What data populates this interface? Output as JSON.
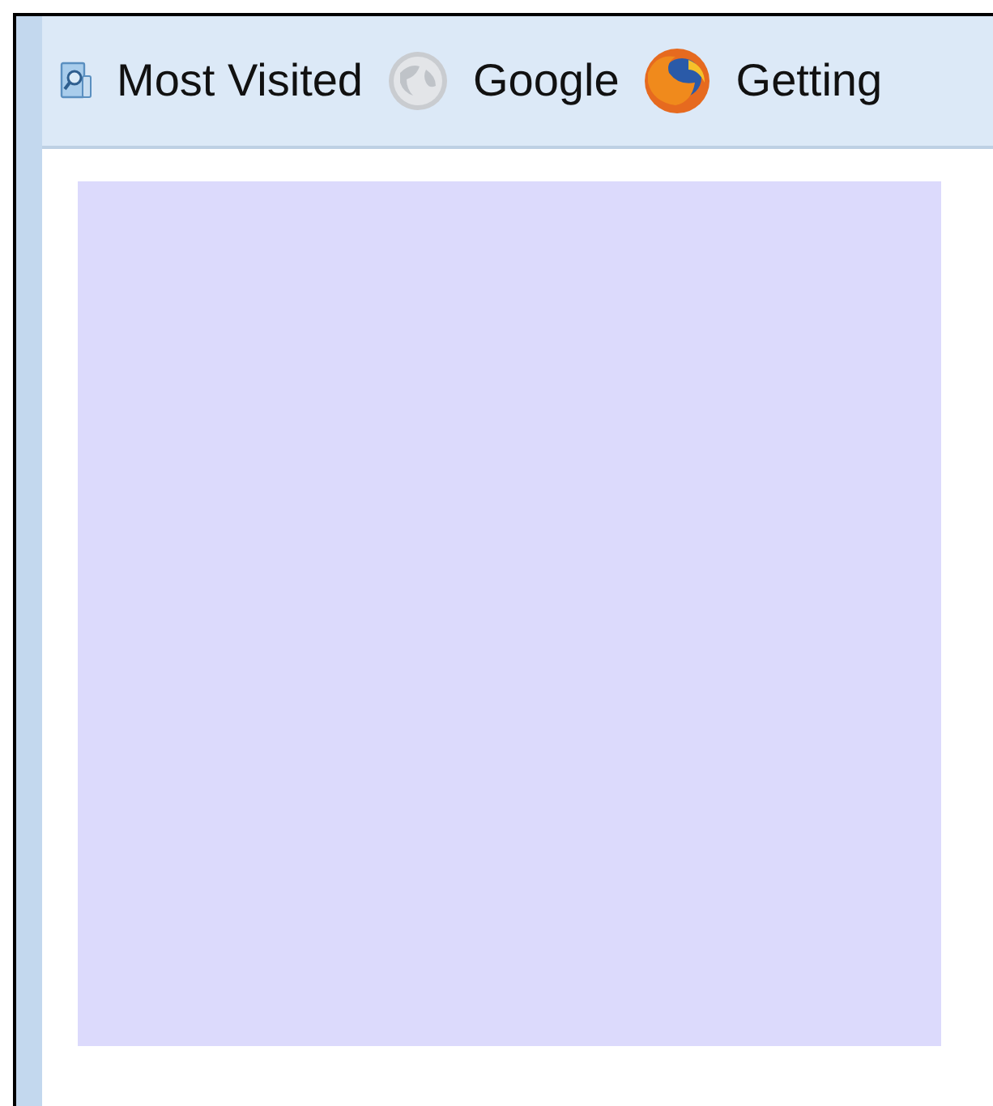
{
  "bookmarks_bar": {
    "items": [
      {
        "kind": "folder",
        "label": "Most Visited"
      },
      {
        "kind": "globe",
        "label": "Google"
      },
      {
        "kind": "firefox",
        "label": "Getting"
      }
    ]
  }
}
